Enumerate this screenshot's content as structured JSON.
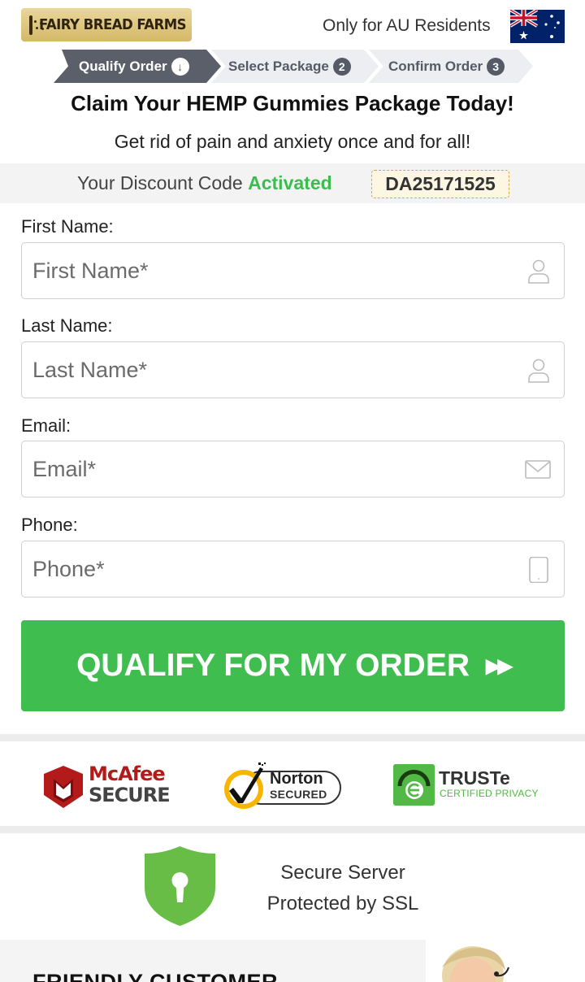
{
  "header": {
    "brand": "FAIRY BREAD FARMS",
    "residents_text": "Only for AU Residents",
    "flag_icon": "australia-flag-icon"
  },
  "steps": [
    {
      "label": "Qualify Order",
      "badge": "↓",
      "state": "active"
    },
    {
      "label": "Select Package",
      "badge": "2",
      "state": "inactive"
    },
    {
      "label": "Confirm Order",
      "badge": "3",
      "state": "inactive"
    }
  ],
  "hero": {
    "title": "Claim Your HEMP Gummies Package Today!",
    "subtitle": "Get rid of pain and anxiety once and for all!"
  },
  "discount": {
    "prefix": "Your Discount Code",
    "status": "Activated",
    "code": "DA25171525"
  },
  "form": {
    "first_name": {
      "label": "First Name:",
      "placeholder": "First Name*",
      "value": "",
      "icon": "user-icon"
    },
    "last_name": {
      "label": "Last Name:",
      "placeholder": "Last Name*",
      "value": "",
      "icon": "user-icon"
    },
    "email": {
      "label": "Email:",
      "placeholder": "Email*",
      "value": "",
      "icon": "envelope-icon"
    },
    "phone": {
      "label": "Phone:",
      "placeholder": "Phone*",
      "value": "",
      "icon": "mobile-phone-icon"
    },
    "submit_label": "QUALIFY FOR MY ORDER",
    "submit_icon": "double-play-arrow-icon"
  },
  "trust": {
    "mcafee_line1": "McAfee",
    "mcafee_line2": "SECURE",
    "norton_line1": "Norton",
    "norton_line2": "SECURED",
    "truste_line1": "TRUSTe",
    "truste_line2": "CERTIFIED PRIVACY"
  },
  "secure": {
    "line1": "Secure Server",
    "line2": "Protected by SSL",
    "icon": "keyhole-shield-icon"
  },
  "support": {
    "heading": "FRIENDLY CUSTOMER"
  },
  "colors": {
    "accent_green": "#3fbe4f",
    "step_active": "#5b5f6a",
    "step_inactive": "#eceef1",
    "coupon_border": "#d2a84a",
    "mcafee_red": "#b31b1b",
    "norton_yellow": "#f7b500",
    "truste_green": "#52b846"
  }
}
